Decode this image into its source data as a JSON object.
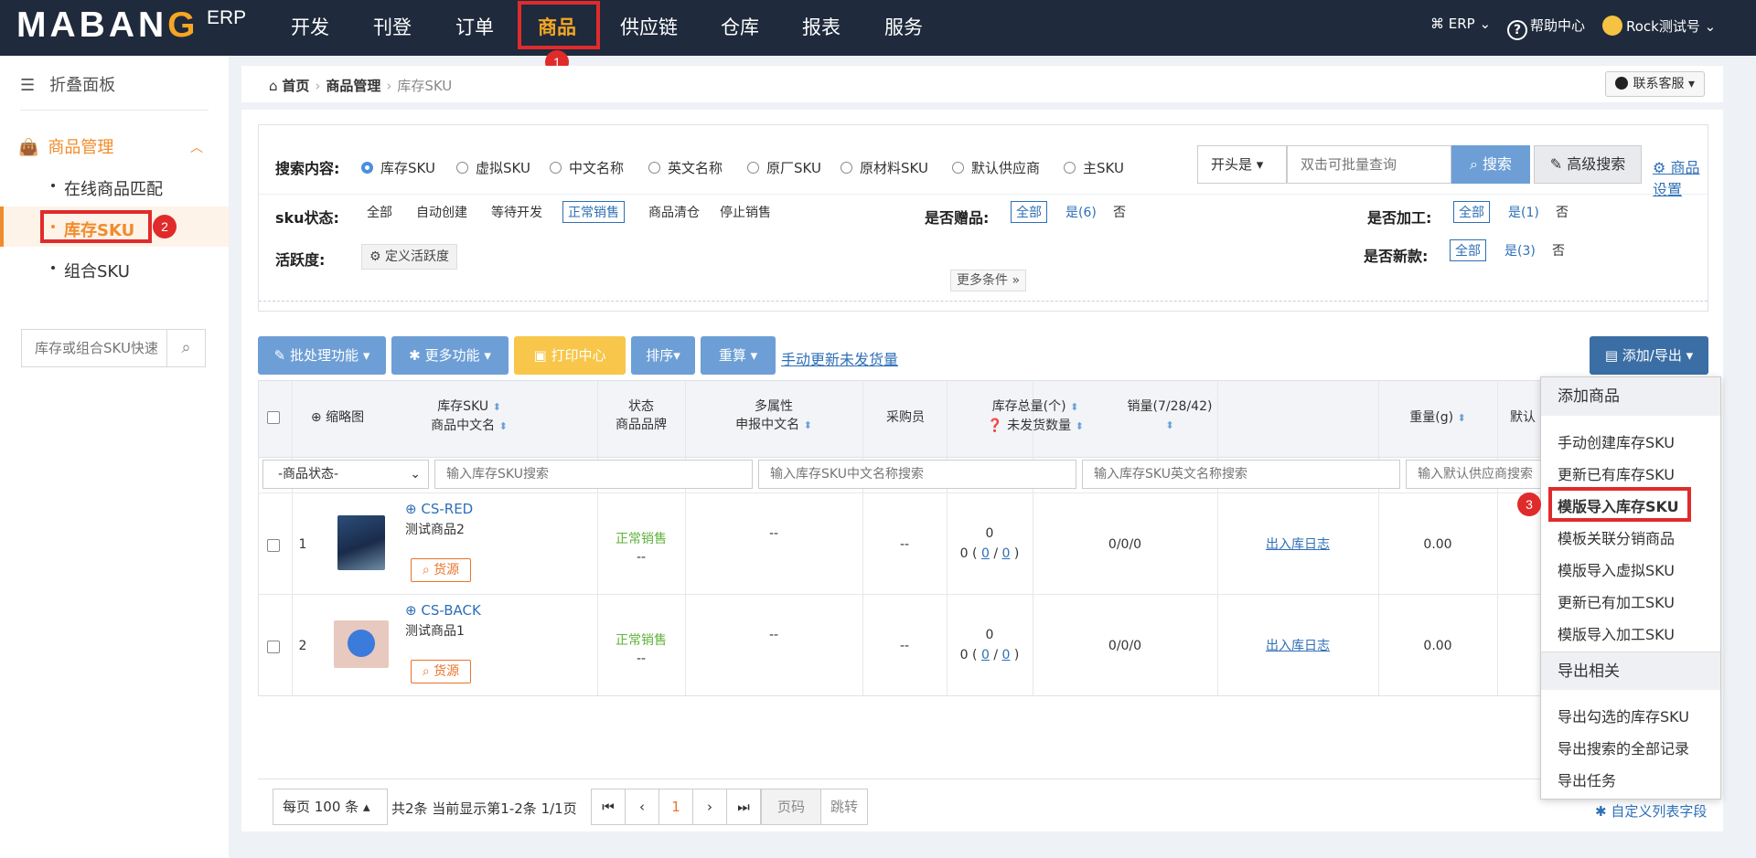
{
  "brand": {
    "logo_left": "MABAN",
    "logo_o": "G",
    "logo_erp": "ERP"
  },
  "nav": {
    "items": [
      "开发",
      "刊登",
      "订单",
      "商品",
      "供应链",
      "仓库",
      "报表",
      "服务"
    ],
    "active": "商品",
    "badge1": "1",
    "erp_menu": "ERP",
    "help": "帮助中心",
    "help_icon": "?",
    "user": "Rock测试号"
  },
  "sidebar": {
    "collapse": "折叠面板",
    "group": "商品管理",
    "items": [
      "在线商品匹配",
      "库存SKU",
      "组合SKU"
    ],
    "badge2": "2",
    "search_placeholder": "库存或组合SKU快速"
  },
  "breadcrumb": {
    "home": "首页",
    "level1": "商品管理",
    "level2": "库存SKU",
    "contact": "联系客服"
  },
  "filter": {
    "search_label": "搜索内容:",
    "radios": [
      "库存SKU",
      "虚拟SKU",
      "中文名称",
      "英文名称",
      "原厂SKU",
      "原材料SKU",
      "默认供应商",
      "主SKU"
    ],
    "match_select": "开头是",
    "input_placeholder": "双击可批量查询",
    "search_btn": "搜索",
    "adv_btn": "高级搜索",
    "settings_link": "商品设置",
    "sku_status_label": "sku状态:",
    "sku_status_opts": [
      "全部",
      "自动创建",
      "等待开发",
      "正常销售",
      "商品清仓",
      "停止销售"
    ],
    "gift_label": "是否赠品:",
    "gift_opts": [
      "全部",
      "是(6)",
      "否"
    ],
    "process_label": "是否加工:",
    "process_opts": [
      "全部",
      "是(1)",
      "否"
    ],
    "activity_label": "活跃度:",
    "activity_btn": "定义活跃度",
    "new_label": "是否新款:",
    "new_opts": [
      "全部",
      "是(3)",
      "否"
    ],
    "more": "更多条件"
  },
  "toolbar": {
    "batch": "批处理功能",
    "more": "更多功能",
    "print": "打印中心",
    "sort": "排序",
    "reset": "重算",
    "update_link": "手动更新未发货量",
    "add_export": "添加/导出"
  },
  "table": {
    "headers": {
      "thumb": "缩略图",
      "sku": "库存SKU",
      "cn_name": "商品中文名",
      "status": "状态",
      "brand": "商品品牌",
      "multi": "多属性",
      "declare": "申报中文名",
      "buyer": "采购员",
      "stock_total": "库存总量(个)",
      "unshipped": "未发货数量",
      "sales": "销量(7/28/42)",
      "weight": "重量(g)",
      "default": "默认"
    },
    "filters": {
      "status_select": "-商品状态-",
      "sku_placeholder": "输入库存SKU搜索",
      "cn_placeholder": "输入库存SKU中文名称搜索",
      "en_placeholder": "输入库存SKU英文名称搜索",
      "supplier_placeholder": "输入默认供应商搜索"
    },
    "rows": [
      {
        "index": "1",
        "sku": "CS-RED",
        "name": "测试商品2",
        "source": "货源",
        "status": "正常销售",
        "brand": "--",
        "multi": "--",
        "buyer": "--",
        "stock": "0",
        "stock_detail_a": "0",
        "stock_detail_b": "0",
        "stock_detail_c": "0",
        "sales": "0/0/0",
        "log": "出入库日志",
        "weight": "0.00"
      },
      {
        "index": "2",
        "sku": "CS-BACK",
        "name": "测试商品1",
        "source": "货源",
        "status": "正常销售",
        "brand": "--",
        "multi": "--",
        "buyer": "--",
        "stock": "0",
        "stock_detail_a": "0",
        "stock_detail_b": "0",
        "stock_detail_c": "0",
        "sales": "0/0/0",
        "log": "出入库日志",
        "weight": "0.00"
      }
    ]
  },
  "pager": {
    "per_page": "每页 100 条",
    "info": "共2条 当前显示第1-2条 1/1页",
    "current": "1",
    "page_input": "页码",
    "jump": "跳转",
    "custom_cols": "自定义列表字段"
  },
  "dropdown": {
    "head1": "添加商品",
    "add_items": [
      "手动创建库存SKU",
      "更新已有库存SKU",
      "模版导入库存SKU",
      "模板关联分销商品",
      "模版导入虚拟SKU",
      "更新已有加工SKU",
      "模版导入加工SKU"
    ],
    "head2": "导出相关",
    "export_items": [
      "导出勾选的库存SKU",
      "导出搜索的全部记录",
      "导出任务"
    ],
    "badge3": "3"
  },
  "colors": {
    "topbar": "#1f2a3c",
    "accent_orange": "#f08c2b",
    "highlight_red": "#e02b2b",
    "primary_blue": "#6d9fd6",
    "link_blue": "#2e6fb7"
  }
}
